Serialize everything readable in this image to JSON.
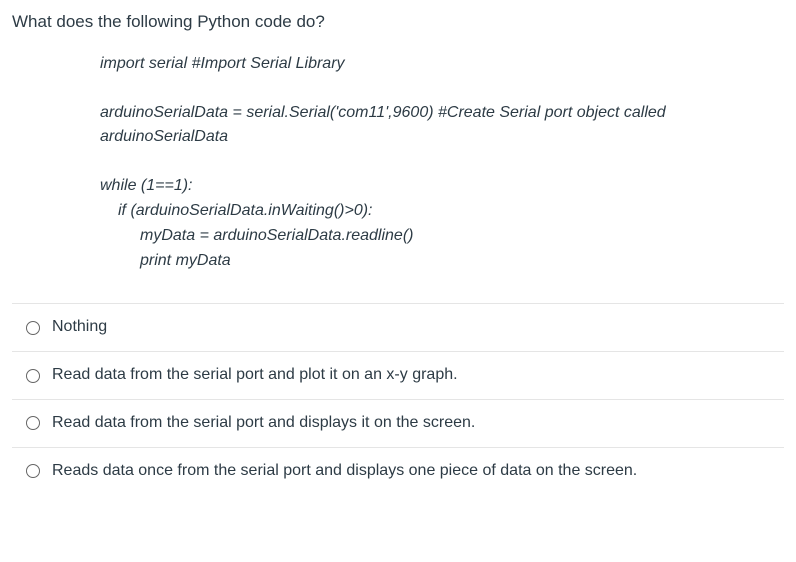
{
  "question": "What does the following Python code do?",
  "code": {
    "l1": "import serial #Import Serial Library",
    "l2": "arduinoSerialData = serial.Serial('com11',9600) #Create Serial port object called",
    "l3": "arduinoSerialData",
    "l4": "while (1==1):",
    "l5": "if (arduinoSerialData.inWaiting()>0):",
    "l6": "myData = arduinoSerialData.readline()",
    "l7": "print myData"
  },
  "options": [
    "Nothing",
    "Read data from the serial port and plot it on an x-y graph.",
    "Read data from the serial port and displays it on the screen.",
    "Reads data once from the serial port and displays one piece of data on the screen."
  ]
}
